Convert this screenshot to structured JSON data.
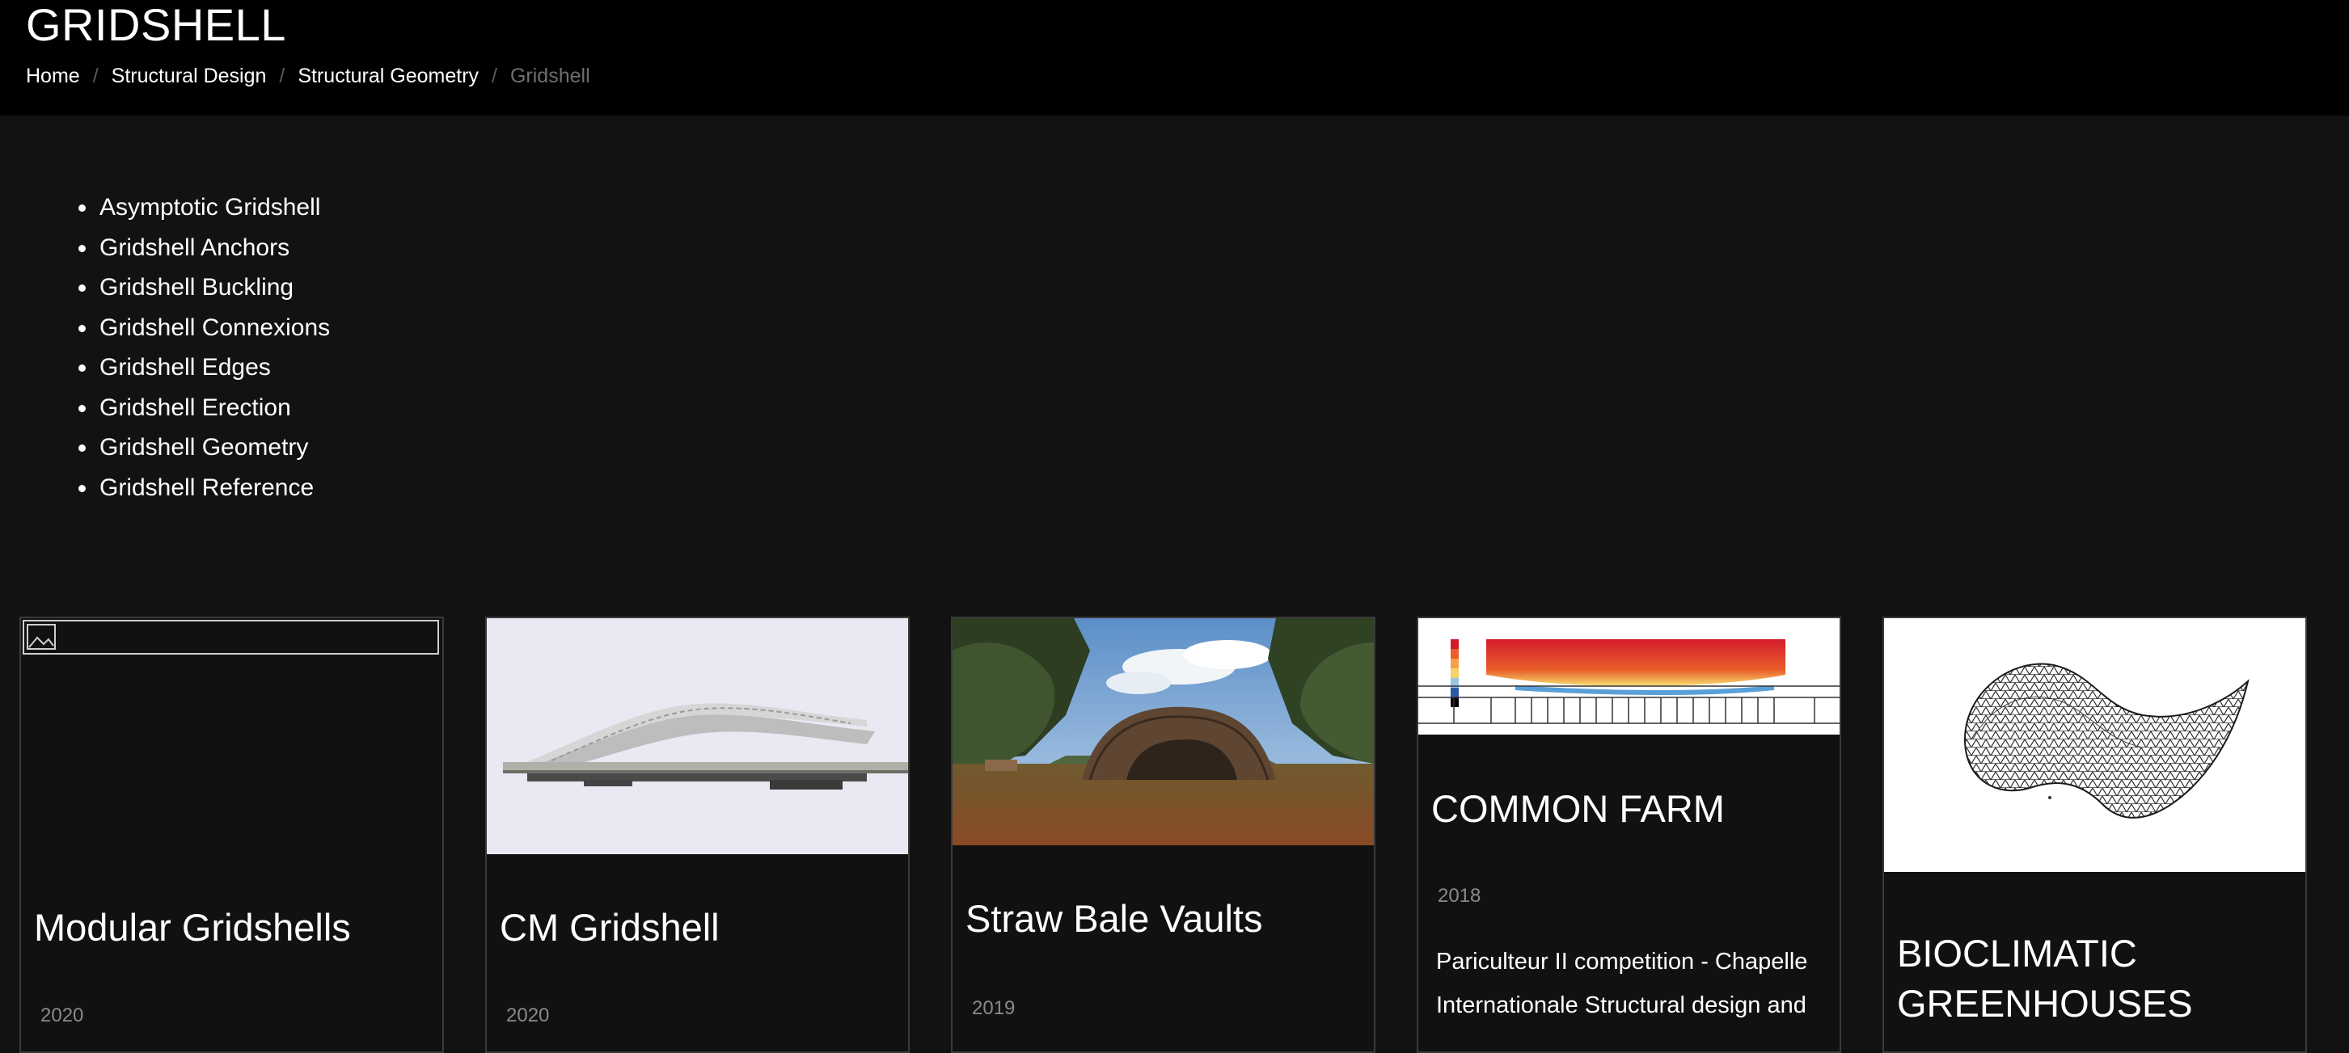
{
  "header": {
    "title": "GRIDSHELL",
    "breadcrumb": [
      "Home",
      "Structural Design",
      "Structural Geometry",
      "Gridshell"
    ],
    "separator": "/"
  },
  "topics": [
    "Asymptotic Gridshell",
    "Gridshell Anchors",
    "Gridshell Buckling",
    "Gridshell Connexions",
    "Gridshell Edges",
    "Gridshell Erection",
    "Gridshell Geometry",
    "Gridshell Reference"
  ],
  "cards": [
    {
      "title": "Modular Gridshells",
      "year": "2020",
      "image": "broken-image"
    },
    {
      "title": "CM Gridshell",
      "year": "2020",
      "image": "white-curved-roof-render"
    },
    {
      "title": "Straw Bale Vaults",
      "year": "2019",
      "image": "vault-in-forest-render"
    },
    {
      "title": "COMMON FARM",
      "year": "2018",
      "image": "thermal-section-diagram",
      "description": "Pariculteur II competition - Chapelle Internationale Structural design and"
    },
    {
      "title": "BIOCLIMATIC GREENHOUSES",
      "year": "",
      "image": "triangulated-gridshell-model"
    }
  ],
  "colors": {
    "header_bg": "#000000",
    "page_bg": "#121212",
    "card_bg": "#111111",
    "card_border": "#3a3a3a",
    "muted_text": "#8a8a8a"
  }
}
